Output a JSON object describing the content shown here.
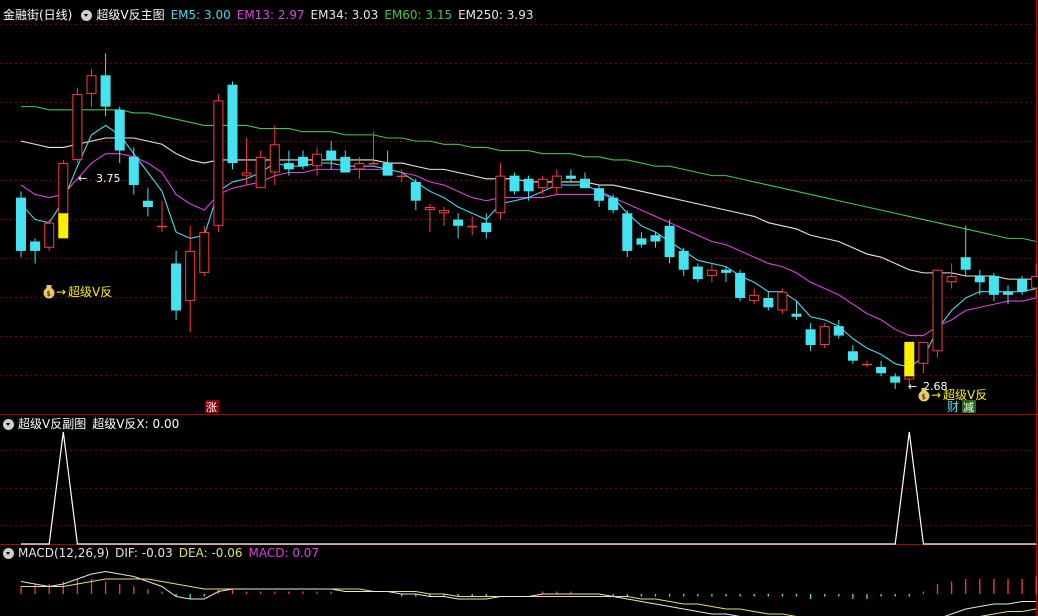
{
  "header": {
    "stock_name": "金融街(日线)",
    "main_indicator": "超级V反主图",
    "ma": [
      {
        "label": "EM5: 3.00",
        "color": "#43d9e9"
      },
      {
        "label": "EM13: 2.97",
        "color": "#e040e0"
      },
      {
        "label": "EM34: 3.03",
        "color": "#e6e6e6"
      },
      {
        "label": "EM60: 3.15",
        "color": "#3ec84a"
      },
      {
        "label": "EM250: 3.93",
        "color": "#e6e6e6"
      }
    ]
  },
  "sub_panel": {
    "title": "超级V反副图",
    "value_label": "超级V反X: 0.00"
  },
  "macd_panel": {
    "title": "MACD(12,26,9)",
    "dif_label": "DIF: -0.03",
    "dea_label": "DEA: -0.06",
    "macd_label": "MACD: 0.07",
    "dif_color": "#e6e6e6",
    "dea_color": "#e6e06a",
    "macd_color": "#e040e0"
  },
  "annotations": {
    "high_label": "3.75",
    "low_label": "2.68",
    "signal_text": "超级V反",
    "badge_zhang": "涨",
    "badge_cai": "财",
    "badge_jian": "减"
  },
  "colors": {
    "up": "#ff3a3a",
    "down": "#45e3f0",
    "signal_bar": "#ffee00",
    "ema5": "#43d9e9",
    "ema13": "#e040e0",
    "ema34": "#e6e6e6",
    "ema60": "#3ec84a",
    "ema250": "#e0e060",
    "grid": "#7a0000",
    "separator": "#b00000"
  },
  "chart_data": {
    "type": "candlestick",
    "price_range": [
      2.6,
      3.92
    ],
    "candles": [
      [
        3.29,
        3.31,
        3.1,
        3.12
      ],
      [
        3.15,
        3.16,
        3.08,
        3.12
      ],
      [
        3.13,
        3.22,
        3.12,
        3.21
      ],
      [
        3.21,
        3.41,
        3.2,
        3.4
      ],
      [
        3.41,
        3.64,
        3.4,
        3.62
      ],
      [
        3.62,
        3.7,
        3.58,
        3.68
      ],
      [
        3.68,
        3.75,
        3.55,
        3.58
      ],
      [
        3.57,
        3.58,
        3.4,
        3.44
      ],
      [
        3.42,
        3.45,
        3.3,
        3.33
      ],
      [
        3.28,
        3.32,
        3.23,
        3.26
      ],
      [
        3.2,
        3.28,
        3.18,
        3.2
      ],
      [
        3.08,
        3.12,
        2.9,
        2.93
      ],
      [
        2.96,
        3.2,
        2.86,
        3.12
      ],
      [
        3.05,
        3.2,
        3.04,
        3.18
      ],
      [
        3.2,
        3.62,
        3.18,
        3.6
      ],
      [
        3.65,
        3.66,
        3.38,
        3.4
      ],
      [
        3.36,
        3.48,
        3.33,
        3.37
      ],
      [
        3.32,
        3.44,
        3.32,
        3.42
      ],
      [
        3.37,
        3.52,
        3.33,
        3.46
      ],
      [
        3.4,
        3.44,
        3.36,
        3.38
      ],
      [
        3.42,
        3.44,
        3.38,
        3.39
      ],
      [
        3.39,
        3.45,
        3.36,
        3.43
      ],
      [
        3.44,
        3.47,
        3.38,
        3.41
      ],
      [
        3.42,
        3.44,
        3.37,
        3.37
      ],
      [
        3.38,
        3.42,
        3.35,
        3.4
      ],
      [
        3.4,
        3.5,
        3.4,
        3.4
      ],
      [
        3.4,
        3.44,
        3.36,
        3.36
      ],
      [
        3.36,
        3.38,
        3.34,
        3.36
      ],
      [
        3.34,
        3.35,
        3.25,
        3.28
      ],
      [
        3.25,
        3.27,
        3.18,
        3.26
      ],
      [
        3.24,
        3.26,
        3.2,
        3.25
      ],
      [
        3.22,
        3.24,
        3.16,
        3.2
      ],
      [
        3.2,
        3.23,
        3.17,
        3.2
      ],
      [
        3.21,
        3.24,
        3.16,
        3.18
      ],
      [
        3.24,
        3.4,
        3.22,
        3.36
      ],
      [
        3.36,
        3.37,
        3.3,
        3.31
      ],
      [
        3.35,
        3.36,
        3.28,
        3.31
      ],
      [
        3.32,
        3.36,
        3.3,
        3.35
      ],
      [
        3.32,
        3.38,
        3.3,
        3.36
      ],
      [
        3.36,
        3.38,
        3.34,
        3.35
      ],
      [
        3.35,
        3.37,
        3.32,
        3.32
      ],
      [
        3.32,
        3.33,
        3.26,
        3.28
      ],
      [
        3.29,
        3.3,
        3.24,
        3.25
      ],
      [
        3.24,
        3.25,
        3.1,
        3.12
      ],
      [
        3.16,
        3.18,
        3.13,
        3.14
      ],
      [
        3.17,
        3.18,
        3.13,
        3.15
      ],
      [
        3.2,
        3.22,
        3.08,
        3.1
      ],
      [
        3.12,
        3.13,
        3.04,
        3.06
      ],
      [
        3.07,
        3.08,
        3.02,
        3.03
      ],
      [
        3.04,
        3.08,
        3.02,
        3.06
      ],
      [
        3.06,
        3.07,
        3.02,
        3.05
      ],
      [
        3.05,
        3.06,
        2.96,
        2.97
      ],
      [
        2.96,
        3.0,
        2.95,
        2.98
      ],
      [
        2.97,
        2.99,
        2.93,
        2.94
      ],
      [
        2.93,
        3.0,
        2.92,
        2.99
      ],
      [
        2.92,
        2.96,
        2.9,
        2.91
      ],
      [
        2.87,
        2.89,
        2.8,
        2.82
      ],
      [
        2.82,
        2.89,
        2.81,
        2.88
      ],
      [
        2.88,
        2.9,
        2.84,
        2.85
      ],
      [
        2.8,
        2.82,
        2.76,
        2.77
      ],
      [
        2.76,
        2.77,
        2.75,
        2.76
      ],
      [
        2.75,
        2.77,
        2.72,
        2.73
      ],
      [
        2.72,
        2.73,
        2.68,
        2.7
      ],
      [
        2.71,
        2.75,
        2.68,
        2.74
      ],
      [
        2.76,
        2.83,
        2.73,
        2.83
      ],
      [
        2.8,
        3.06,
        2.78,
        3.06
      ],
      [
        3.02,
        3.08,
        3.0,
        3.04
      ],
      [
        3.1,
        3.2,
        3.04,
        3.06
      ],
      [
        3.04,
        3.06,
        2.98,
        3.02
      ],
      [
        3.04,
        3.05,
        2.96,
        2.98
      ],
      [
        2.99,
        3.01,
        2.95,
        2.98
      ],
      [
        3.03,
        3.04,
        2.98,
        2.99
      ],
      [
        3.0,
        3.08,
        2.97,
        3.04
      ]
    ],
    "signal_bars": [
      3,
      63
    ],
    "signal_ranges": [
      [
        3.16,
        3.24
      ],
      [
        2.72,
        2.83
      ]
    ],
    "ema5": [
      3.27,
      3.22,
      3.21,
      3.28,
      3.39,
      3.49,
      3.52,
      3.49,
      3.43,
      3.37,
      3.31,
      3.18,
      3.16,
      3.17,
      3.31,
      3.34,
      3.35,
      3.37,
      3.4,
      3.39,
      3.39,
      3.4,
      3.4,
      3.39,
      3.39,
      3.39,
      3.38,
      3.37,
      3.34,
      3.31,
      3.29,
      3.26,
      3.24,
      3.22,
      3.27,
      3.28,
      3.29,
      3.31,
      3.33,
      3.33,
      3.33,
      3.31,
      3.29,
      3.24,
      3.2,
      3.18,
      3.15,
      3.12,
      3.09,
      3.08,
      3.07,
      3.04,
      3.02,
      2.99,
      2.99,
      2.96,
      2.91,
      2.9,
      2.88,
      2.84,
      2.81,
      2.79,
      2.76,
      2.75,
      2.78,
      2.87,
      2.93,
      2.97,
      2.99,
      2.99,
      2.99,
      2.99,
      3.0
    ],
    "ema13": [
      3.33,
      3.3,
      3.29,
      3.3,
      3.35,
      3.4,
      3.43,
      3.43,
      3.42,
      3.4,
      3.37,
      3.3,
      3.27,
      3.25,
      3.3,
      3.32,
      3.33,
      3.34,
      3.36,
      3.37,
      3.37,
      3.38,
      3.38,
      3.38,
      3.38,
      3.38,
      3.38,
      3.37,
      3.36,
      3.34,
      3.33,
      3.31,
      3.29,
      3.28,
      3.29,
      3.29,
      3.29,
      3.29,
      3.3,
      3.3,
      3.3,
      3.3,
      3.29,
      3.27,
      3.25,
      3.23,
      3.21,
      3.19,
      3.17,
      3.15,
      3.14,
      3.12,
      3.1,
      3.08,
      3.07,
      3.05,
      3.02,
      3.0,
      2.98,
      2.95,
      2.92,
      2.9,
      2.87,
      2.85,
      2.85,
      2.88,
      2.9,
      2.93,
      2.94,
      2.95,
      2.96,
      2.96,
      2.97
    ],
    "ema34": [
      3.47,
      3.46,
      3.45,
      3.45,
      3.46,
      3.47,
      3.48,
      3.48,
      3.48,
      3.47,
      3.46,
      3.43,
      3.41,
      3.4,
      3.41,
      3.41,
      3.41,
      3.41,
      3.41,
      3.41,
      3.41,
      3.41,
      3.41,
      3.41,
      3.41,
      3.41,
      3.4,
      3.4,
      3.39,
      3.38,
      3.38,
      3.37,
      3.36,
      3.35,
      3.35,
      3.35,
      3.34,
      3.34,
      3.34,
      3.34,
      3.34,
      3.33,
      3.33,
      3.32,
      3.31,
      3.3,
      3.29,
      3.28,
      3.27,
      3.26,
      3.25,
      3.24,
      3.23,
      3.21,
      3.2,
      3.19,
      3.17,
      3.16,
      3.15,
      3.13,
      3.11,
      3.1,
      3.08,
      3.06,
      3.05,
      3.05,
      3.05,
      3.04,
      3.04,
      3.04,
      3.03,
      3.03,
      3.03
    ],
    "ema60": [
      3.58,
      3.58,
      3.57,
      3.57,
      3.57,
      3.57,
      3.57,
      3.57,
      3.56,
      3.56,
      3.55,
      3.54,
      3.53,
      3.52,
      3.52,
      3.52,
      3.52,
      3.51,
      3.51,
      3.51,
      3.5,
      3.5,
      3.5,
      3.49,
      3.49,
      3.49,
      3.48,
      3.48,
      3.47,
      3.47,
      3.46,
      3.46,
      3.45,
      3.45,
      3.44,
      3.44,
      3.44,
      3.43,
      3.43,
      3.43,
      3.42,
      3.42,
      3.41,
      3.41,
      3.4,
      3.39,
      3.39,
      3.38,
      3.37,
      3.36,
      3.36,
      3.35,
      3.34,
      3.33,
      3.32,
      3.31,
      3.3,
      3.29,
      3.28,
      3.27,
      3.26,
      3.25,
      3.24,
      3.23,
      3.22,
      3.21,
      3.2,
      3.19,
      3.18,
      3.17,
      3.16,
      3.16,
      3.15
    ],
    "ema250": [
      4.48,
      4.47,
      4.46,
      4.45,
      4.44,
      4.43,
      4.42,
      4.41,
      4.4,
      4.39,
      4.38,
      4.37,
      4.36,
      4.35,
      4.34,
      4.33,
      4.32,
      4.31,
      4.3,
      4.29,
      4.28,
      4.27,
      4.26,
      4.25,
      4.24,
      4.23,
      4.22,
      4.21,
      4.2,
      4.19,
      4.18,
      4.17,
      4.16,
      4.15,
      4.14,
      4.14,
      4.13,
      4.12,
      4.11,
      4.1,
      4.09,
      4.08,
      4.08,
      4.07,
      4.06,
      4.05,
      4.05,
      4.04,
      4.03,
      4.03,
      4.02,
      4.02,
      4.01,
      4.01,
      4.0,
      4.0,
      3.99,
      3.99,
      3.98,
      3.98,
      3.97,
      3.97,
      3.96,
      3.96,
      3.96,
      3.95,
      3.95,
      3.95,
      3.94,
      3.94,
      3.94,
      3.93,
      3.93
    ],
    "sub_signal": [
      0,
      0,
      0,
      1,
      0,
      0,
      0,
      0,
      0,
      0,
      0,
      0,
      0,
      0,
      0,
      0,
      0,
      0,
      0,
      0,
      0,
      0,
      0,
      0,
      0,
      0,
      0,
      0,
      0,
      0,
      0,
      0,
      0,
      0,
      0,
      0,
      0,
      0,
      0,
      0,
      0,
      0,
      0,
      0,
      0,
      0,
      0,
      0,
      0,
      0,
      0,
      0,
      0,
      0,
      0,
      0,
      0,
      0,
      0,
      0,
      0,
      0,
      0,
      1,
      0,
      0,
      0,
      0,
      0,
      0,
      0,
      0,
      0
    ],
    "macd_hist": [
      0.03,
      0.04,
      0.04,
      0.05,
      0.06,
      0.06,
      0.05,
      0.04,
      0.03,
      0.02,
      0.01,
      -0.01,
      -0.02,
      -0.01,
      0.02,
      0.02,
      0.01,
      0.01,
      0.01,
      0.01,
      0.01,
      0.01,
      0.01,
      0.0,
      0.0,
      0.0,
      0.0,
      -0.01,
      -0.01,
      -0.01,
      -0.01,
      -0.01,
      -0.01,
      -0.01,
      0.0,
      0.0,
      0.0,
      0.01,
      0.01,
      0.01,
      0.0,
      0.0,
      -0.01,
      -0.01,
      -0.01,
      -0.01,
      -0.01,
      -0.01,
      -0.01,
      -0.01,
      -0.01,
      -0.01,
      -0.01,
      -0.01,
      -0.01,
      -0.01,
      -0.02,
      -0.01,
      -0.01,
      -0.02,
      -0.02,
      -0.01,
      -0.01,
      -0.01,
      0.01,
      0.04,
      0.05,
      0.06,
      0.06,
      0.06,
      0.06,
      0.06,
      0.07
    ],
    "dif": [
      0.05,
      0.04,
      0.03,
      0.04,
      0.06,
      0.08,
      0.09,
      0.08,
      0.07,
      0.05,
      0.03,
      -0.01,
      -0.02,
      -0.02,
      0.01,
      0.02,
      0.02,
      0.02,
      0.02,
      0.02,
      0.02,
      0.02,
      0.02,
      0.01,
      0.01,
      0.01,
      0.01,
      0.0,
      0.0,
      -0.01,
      -0.01,
      -0.02,
      -0.02,
      -0.02,
      -0.01,
      -0.01,
      -0.01,
      0.0,
      0.0,
      0.0,
      0.0,
      0.0,
      -0.01,
      -0.02,
      -0.03,
      -0.04,
      -0.05,
      -0.06,
      -0.07,
      -0.08,
      -0.08,
      -0.09,
      -0.1,
      -0.1,
      -0.1,
      -0.11,
      -0.12,
      -0.12,
      -0.12,
      -0.13,
      -0.14,
      -0.14,
      -0.14,
      -0.14,
      -0.13,
      -0.1,
      -0.08,
      -0.06,
      -0.05,
      -0.04,
      -0.04,
      -0.03,
      -0.03
    ],
    "dea": [
      0.03,
      0.03,
      0.03,
      0.03,
      0.04,
      0.05,
      0.06,
      0.06,
      0.06,
      0.06,
      0.05,
      0.04,
      0.03,
      0.02,
      0.02,
      0.02,
      0.02,
      0.02,
      0.02,
      0.02,
      0.02,
      0.02,
      0.02,
      0.02,
      0.02,
      0.01,
      0.01,
      0.01,
      0.01,
      0.0,
      0.0,
      -0.01,
      -0.01,
      -0.01,
      -0.01,
      -0.01,
      -0.01,
      -0.01,
      -0.01,
      -0.01,
      -0.01,
      -0.01,
      -0.01,
      -0.01,
      -0.02,
      -0.02,
      -0.03,
      -0.04,
      -0.04,
      -0.05,
      -0.06,
      -0.06,
      -0.07,
      -0.08,
      -0.08,
      -0.09,
      -0.09,
      -0.1,
      -0.1,
      -0.11,
      -0.11,
      -0.12,
      -0.12,
      -0.13,
      -0.13,
      -0.12,
      -0.11,
      -0.1,
      -0.09,
      -0.08,
      -0.07,
      -0.07,
      -0.06
    ]
  }
}
